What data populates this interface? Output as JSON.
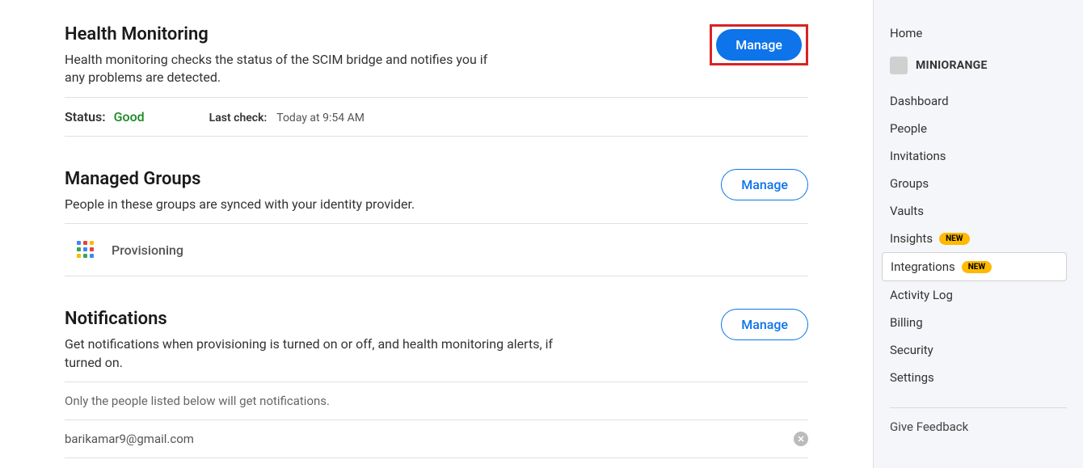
{
  "sections": {
    "health": {
      "title": "Health Monitoring",
      "desc": "Health monitoring checks the status of the SCIM bridge and notifies you if any problems are detected.",
      "manage_label": "Manage",
      "status_label": "Status:",
      "status_value": "Good",
      "check_label": "Last check:",
      "check_value": "Today at 9:54 AM"
    },
    "groups": {
      "title": "Managed Groups",
      "desc": "People in these groups are synced with your identity provider.",
      "manage_label": "Manage",
      "group_name": "Provisioning"
    },
    "notifications": {
      "title": "Notifications",
      "desc": "Get notifications when provisioning is turned on or off, and health monitoring alerts, if turned on.",
      "manage_label": "Manage",
      "note": "Only the people listed below will get notifications.",
      "email": "barikamar9@gmail.com"
    }
  },
  "sidebar": {
    "home": "Home",
    "org": "MINIORANGE",
    "items": [
      {
        "label": "Dashboard",
        "badge": ""
      },
      {
        "label": "People",
        "badge": ""
      },
      {
        "label": "Invitations",
        "badge": ""
      },
      {
        "label": "Groups",
        "badge": ""
      },
      {
        "label": "Vaults",
        "badge": ""
      },
      {
        "label": "Insights",
        "badge": "NEW"
      },
      {
        "label": "Integrations",
        "badge": "NEW"
      },
      {
        "label": "Activity Log",
        "badge": ""
      },
      {
        "label": "Billing",
        "badge": ""
      },
      {
        "label": "Security",
        "badge": ""
      },
      {
        "label": "Settings",
        "badge": ""
      }
    ],
    "feedback": "Give Feedback"
  }
}
